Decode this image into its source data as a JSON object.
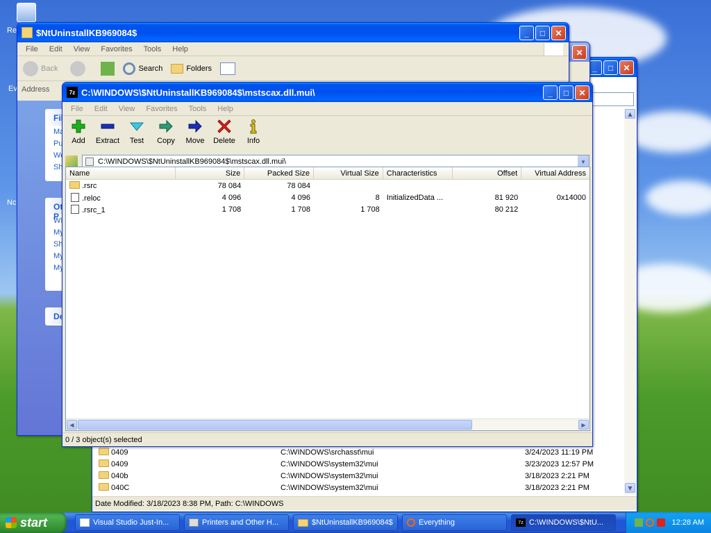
{
  "desktop": {
    "left_labels": [
      "Re",
      "Ev",
      "Nc"
    ]
  },
  "back_window": {
    "rows": [
      {
        "name": "0409",
        "path": "C:\\WINDOWS\\srchasst\\mui",
        "date": "3/24/2023 11:19 PM"
      },
      {
        "name": "0409",
        "path": "C:\\WINDOWS\\system32\\mui",
        "date": "3/23/2023 12:57 PM"
      },
      {
        "name": "040b",
        "path": "C:\\WINDOWS\\system32\\mui",
        "date": "3/18/2023 2:21 PM"
      },
      {
        "name": "040C",
        "path": "C:\\WINDOWS\\system32\\mui",
        "date": "3/18/2023 2:21 PM"
      }
    ],
    "status": "Date Modified: 3/18/2023 8:38 PM, Path: C:\\WINDOWS"
  },
  "explorer": {
    "title": "$NtUninstallKB969084$",
    "menu": [
      "File",
      "Edit",
      "View",
      "Favorites",
      "Tools",
      "Help"
    ],
    "back_label": "Back",
    "search_label": "Search",
    "folders_label": "Folders",
    "address_label": "Address",
    "panel_file": "File an",
    "panel_file_items": [
      "Ma",
      "Pul",
      "We",
      "Sha"
    ],
    "panel_other": "Other P",
    "panel_other_items": [
      "WI",
      "My",
      "Sha",
      "My",
      "My"
    ],
    "panel_details": "Details"
  },
  "sevenzip": {
    "title": "C:\\WINDOWS\\$NtUninstallKB969084$\\mstscax.dll.mui\\",
    "menu": [
      "File",
      "Edit",
      "View",
      "Favorites",
      "Tools",
      "Help"
    ],
    "toolbar": {
      "add": "Add",
      "extract": "Extract",
      "test": "Test",
      "copy": "Copy",
      "move": "Move",
      "delete": "Delete",
      "info": "Info"
    },
    "path": "C:\\WINDOWS\\$NtUninstallKB969084$\\mstscax.dll.mui\\",
    "columns": [
      "Name",
      "Size",
      "Packed Size",
      "Virtual Size",
      "Characteristics",
      "Offset",
      "Virtual Address"
    ],
    "rows": [
      {
        "name": ".rsrc",
        "size": "78 084",
        "packed": "78 084",
        "vsize": "",
        "chars": "",
        "offset": "",
        "vaddr": "",
        "folder": true
      },
      {
        "name": ".reloc",
        "size": "4 096",
        "packed": "4 096",
        "vsize": "8",
        "chars": "InitializedData ...",
        "offset": "81 920",
        "vaddr": "0x14000",
        "folder": false
      },
      {
        "name": ".rsrc_1",
        "size": "1 708",
        "packed": "1 708",
        "vsize": "1 708",
        "chars": "",
        "offset": "80 212",
        "vaddr": "",
        "folder": false
      }
    ],
    "status": "0 / 3 object(s) selected"
  },
  "taskbar": {
    "start_label": "start",
    "tasks": [
      {
        "label": "Visual Studio Just-In...",
        "active": false
      },
      {
        "label": "Printers and Other H...",
        "active": false
      },
      {
        "label": "$NtUninstallKB969084$",
        "active": false
      },
      {
        "label": "Everything",
        "active": false
      },
      {
        "label": "C:\\WINDOWS\\$NtU...",
        "active": true
      }
    ],
    "clock": "12:28 AM"
  }
}
